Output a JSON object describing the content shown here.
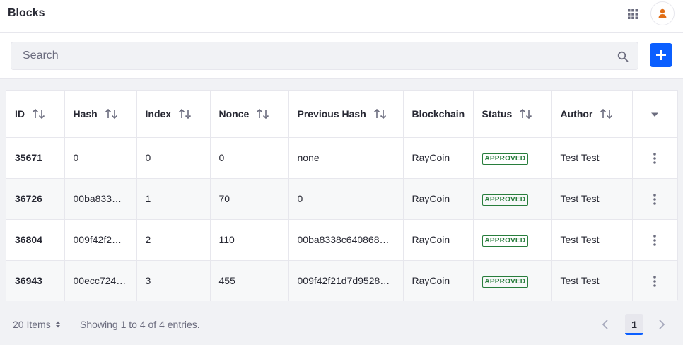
{
  "header": {
    "title": "Blocks",
    "apps_icon": "grid-apps-icon",
    "avatar_icon": "user-avatar-icon",
    "avatar_color": "#e16e16"
  },
  "search": {
    "placeholder": "Search",
    "value": "",
    "icon": "search-icon"
  },
  "add_button": {
    "icon": "plus-icon",
    "color": "#0b5fff"
  },
  "table": {
    "columns": [
      {
        "label": "ID",
        "sortable": true
      },
      {
        "label": "Hash",
        "sortable": true
      },
      {
        "label": "Index",
        "sortable": true
      },
      {
        "label": "Nonce",
        "sortable": true
      },
      {
        "label": "Previous Hash",
        "sortable": true
      },
      {
        "label": "Blockchain",
        "sortable": false
      },
      {
        "label": "Status",
        "sortable": true
      },
      {
        "label": "Author",
        "sortable": true
      }
    ],
    "rows": [
      {
        "id": "35671",
        "hash": "0",
        "index": "0",
        "nonce": "0",
        "previous_hash": "none",
        "blockchain": "RayCoin",
        "status": "APPROVED",
        "author": "Test Test"
      },
      {
        "id": "36726",
        "hash": "00ba833…",
        "index": "1",
        "nonce": "70",
        "previous_hash": "0",
        "blockchain": "RayCoin",
        "status": "APPROVED",
        "author": "Test Test"
      },
      {
        "id": "36804",
        "hash": "009f42f2…",
        "index": "2",
        "nonce": "110",
        "previous_hash": "00ba8338c640868…",
        "blockchain": "RayCoin",
        "status": "APPROVED",
        "author": "Test Test"
      },
      {
        "id": "36943",
        "hash": "00ecc724…",
        "index": "3",
        "nonce": "455",
        "previous_hash": "009f42f21d7d9528…",
        "blockchain": "RayCoin",
        "status": "APPROVED",
        "author": "Test Test"
      }
    ],
    "status_color": "#287d3c"
  },
  "pagination": {
    "items_per_page": "20 Items",
    "showing": "Showing 1 to 4 of 4 entries.",
    "current_page": "1"
  }
}
